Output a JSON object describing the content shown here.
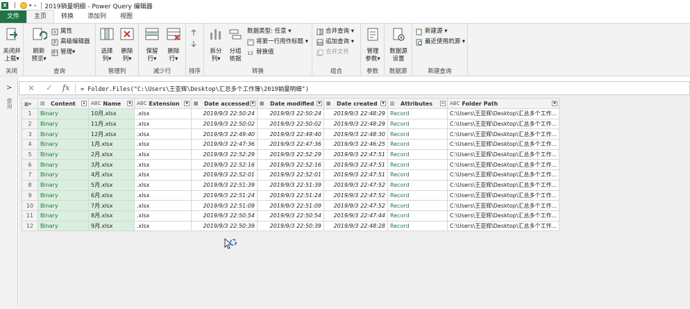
{
  "window": {
    "title": "2019销量明细 - Power Query 编辑器"
  },
  "tabs": [
    {
      "label": "文件"
    },
    {
      "label": "主页"
    },
    {
      "label": "转换"
    },
    {
      "label": "添加列"
    },
    {
      "label": "视图"
    }
  ],
  "ribbon": {
    "close": {
      "btn": "关闭并上载",
      "label_l1": "关闭并",
      "label_l2": "上载▾",
      "group": "关闭"
    },
    "query": {
      "refresh_l1": "刷新",
      "refresh_l2": "预览▾",
      "properties": "属性",
      "adv_editor": "高级编辑器",
      "manage": "管理▾",
      "group": "查询"
    },
    "manage_cols": {
      "choose_l1": "选择",
      "choose_l2": "列▾",
      "remove_l1": "删除",
      "remove_l2": "列▾",
      "group": "管理列"
    },
    "reduce_rows": {
      "keep_l1": "保留",
      "keep_l2": "行▾",
      "remove_l1": "删除",
      "remove_l2": "行▾",
      "group": "减少行"
    },
    "sort": {
      "group": "排序"
    },
    "transform": {
      "split_l1": "拆分",
      "split_l2": "列▾",
      "group_l1": "分组",
      "group_l2": "依据",
      "datatype": "数据类型: 任意 ▾",
      "firstrow": "将第一行用作标题 ▾",
      "replace": "替换值",
      "group": "转换"
    },
    "combine": {
      "merge": "合并查询 ▾",
      "append": "追加查询 ▾",
      "combine_files": "合并文件",
      "group": "组合"
    },
    "params": {
      "manage_l1": "管理",
      "manage_l2": "参数▾",
      "group": "参数"
    },
    "datasource": {
      "settings_l1": "数据源",
      "settings_l2": "设置",
      "group": "数据源"
    },
    "newquery": {
      "new_source": "新建源 ▾",
      "recent": "最近使用的源 ▾",
      "group": "新建查询"
    }
  },
  "navigator": {
    "label": "查询"
  },
  "formula": {
    "text": "= Folder.Files(\"C:\\Users\\王亚辉\\Desktop\\汇总多个工作簿\\2019销量明细\")"
  },
  "columns": [
    {
      "type_icon": "▤",
      "name": "Content",
      "extra": "⇊"
    },
    {
      "type_icon": "ABC",
      "name": "Name"
    },
    {
      "type_icon": "ABC",
      "name": "Extension"
    },
    {
      "type_icon": "▦",
      "name": "Date accessed"
    },
    {
      "type_icon": "▦",
      "name": "Date modified"
    },
    {
      "type_icon": "▦",
      "name": "Date created"
    },
    {
      "type_icon": "▥",
      "name": "Attributes",
      "extra": "⇔"
    },
    {
      "type_icon": "ABC",
      "name": "Folder Path"
    }
  ],
  "rows": [
    {
      "n": "1",
      "content": "Binary",
      "name": "10月.xlsx",
      "ext": ".xlsx",
      "acc": "2019/9/3 22:50:24",
      "mod": "2019/9/3 22:50:24",
      "cre": "2019/9/3 22:48:29",
      "attr": "Record",
      "path": "C:\\Users\\王亚辉\\Desktop\\汇总多个工作..."
    },
    {
      "n": "2",
      "content": "Binary",
      "name": "11月.xlsx",
      "ext": ".xlsx",
      "acc": "2019/9/3 22:50:02",
      "mod": "2019/9/3 22:50:02",
      "cre": "2019/9/3 22:48:29",
      "attr": "Record",
      "path": "C:\\Users\\王亚辉\\Desktop\\汇总多个工作..."
    },
    {
      "n": "3",
      "content": "Binary",
      "name": "12月.xlsx",
      "ext": ".xlsx",
      "acc": "2019/9/3 22:49:40",
      "mod": "2019/9/3 22:49:40",
      "cre": "2019/9/3 22:48:30",
      "attr": "Record",
      "path": "C:\\Users\\王亚辉\\Desktop\\汇总多个工作..."
    },
    {
      "n": "4",
      "content": "Binary",
      "name": "1月.xlsx",
      "ext": ".xlsx",
      "acc": "2019/9/3 22:47:36",
      "mod": "2019/9/3 22:47:36",
      "cre": "2019/9/3 22:46:25",
      "attr": "Record",
      "path": "C:\\Users\\王亚辉\\Desktop\\汇总多个工作..."
    },
    {
      "n": "5",
      "content": "Binary",
      "name": "2月.xlsx",
      "ext": ".xlsx",
      "acc": "2019/9/3 22:52:29",
      "mod": "2019/9/3 22:52:29",
      "cre": "2019/9/3 22:47:51",
      "attr": "Record",
      "path": "C:\\Users\\王亚辉\\Desktop\\汇总多个工作..."
    },
    {
      "n": "6",
      "content": "Binary",
      "name": "3月.xlsx",
      "ext": ".xlsx",
      "acc": "2019/9/3 22:52:16",
      "mod": "2019/9/3 22:52:16",
      "cre": "2019/9/3 22:47:51",
      "attr": "Record",
      "path": "C:\\Users\\王亚辉\\Desktop\\汇总多个工作..."
    },
    {
      "n": "7",
      "content": "Binary",
      "name": "4月.xlsx",
      "ext": ".xlsx",
      "acc": "2019/9/3 22:52:01",
      "mod": "2019/9/3 22:52:01",
      "cre": "2019/9/3 22:47:51",
      "attr": "Record",
      "path": "C:\\Users\\王亚辉\\Desktop\\汇总多个工作..."
    },
    {
      "n": "8",
      "content": "Binary",
      "name": "5月.xlsx",
      "ext": ".xlsx",
      "acc": "2019/9/3 22:51:39",
      "mod": "2019/9/3 22:51:39",
      "cre": "2019/9/3 22:47:52",
      "attr": "Record",
      "path": "C:\\Users\\王亚辉\\Desktop\\汇总多个工作..."
    },
    {
      "n": "9",
      "content": "Binary",
      "name": "6月.xlsx",
      "ext": ".xlsx",
      "acc": "2019/9/3 22:51:24",
      "mod": "2019/9/3 22:51:24",
      "cre": "2019/9/3 22:47:52",
      "attr": "Record",
      "path": "C:\\Users\\王亚辉\\Desktop\\汇总多个工作..."
    },
    {
      "n": "10",
      "content": "Binary",
      "name": "7月.xlsx",
      "ext": ".xlsx",
      "acc": "2019/9/3 22:51:09",
      "mod": "2019/9/3 22:51:09",
      "cre": "2019/9/3 22:47:52",
      "attr": "Record",
      "path": "C:\\Users\\王亚辉\\Desktop\\汇总多个工作..."
    },
    {
      "n": "11",
      "content": "Binary",
      "name": "8月.xlsx",
      "ext": ".xlsx",
      "acc": "2019/9/3 22:50:54",
      "mod": "2019/9/3 22:50:54",
      "cre": "2019/9/3 22:47:44",
      "attr": "Record",
      "path": "C:\\Users\\王亚辉\\Desktop\\汇总多个工作..."
    },
    {
      "n": "12",
      "content": "Binary",
      "name": "9月.xlsx",
      "ext": ".xlsx",
      "acc": "2019/9/3 22:50:39",
      "mod": "2019/9/3 22:50:39",
      "cre": "2019/9/3 22:48:28",
      "attr": "Record",
      "path": "C:\\Users\\王亚辉\\Desktop\\汇总多个工作..."
    }
  ],
  "colors": {
    "accent": "#217346",
    "binary_bg": "#dbefdf"
  }
}
